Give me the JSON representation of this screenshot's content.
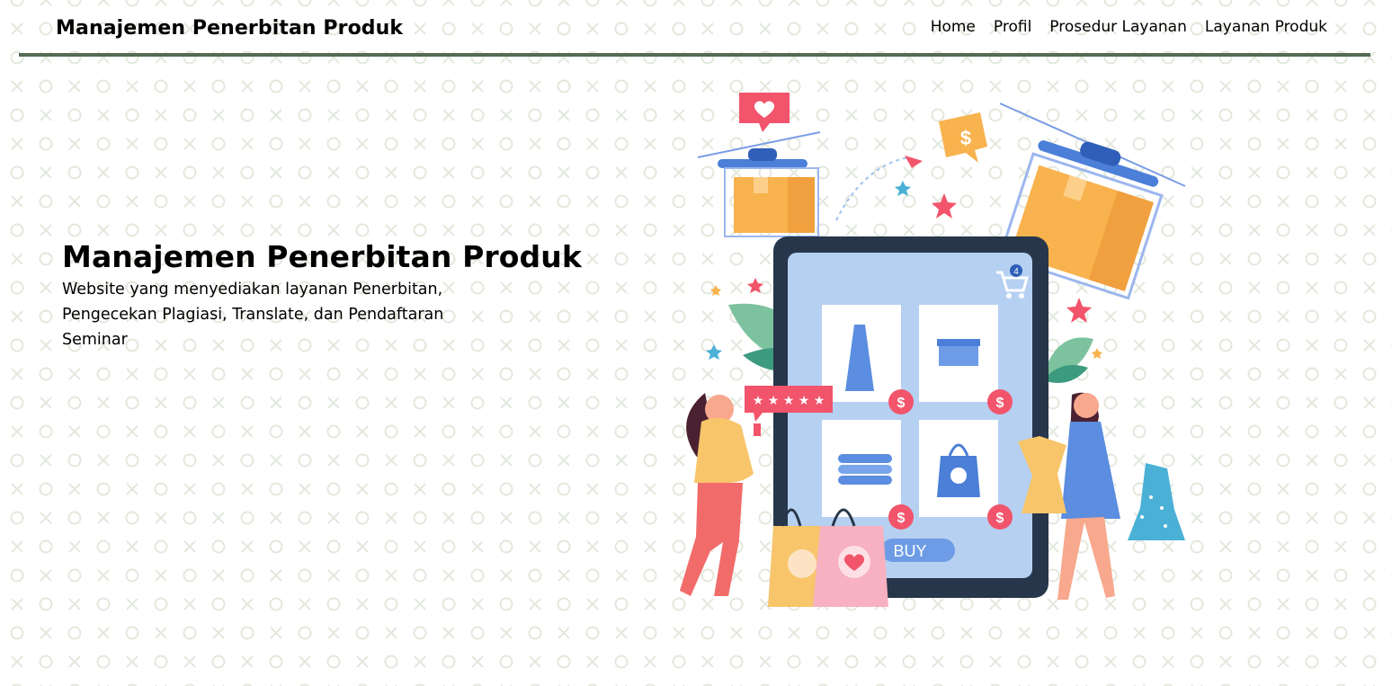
{
  "navbar": {
    "brand": "Manajemen Penerbitan Produk",
    "links": [
      {
        "label": "Home"
      },
      {
        "label": "Profil"
      },
      {
        "label": "Prosedur Layanan"
      },
      {
        "label": "Layanan Produk"
      }
    ]
  },
  "hero": {
    "title": "Manajemen Penerbitan Produk",
    "description": "Website yang menyediakan layanan Penerbitan, Pengecekan Plagiasi, Translate, dan Pendaftaran Seminar"
  },
  "illustration": {
    "buy_label": "BUY",
    "cart_count": "4",
    "rating_text": "★ ★ ★ ★ ★"
  },
  "colors": {
    "accent_rule": "#536b55",
    "pattern": "#e3e8dc"
  }
}
